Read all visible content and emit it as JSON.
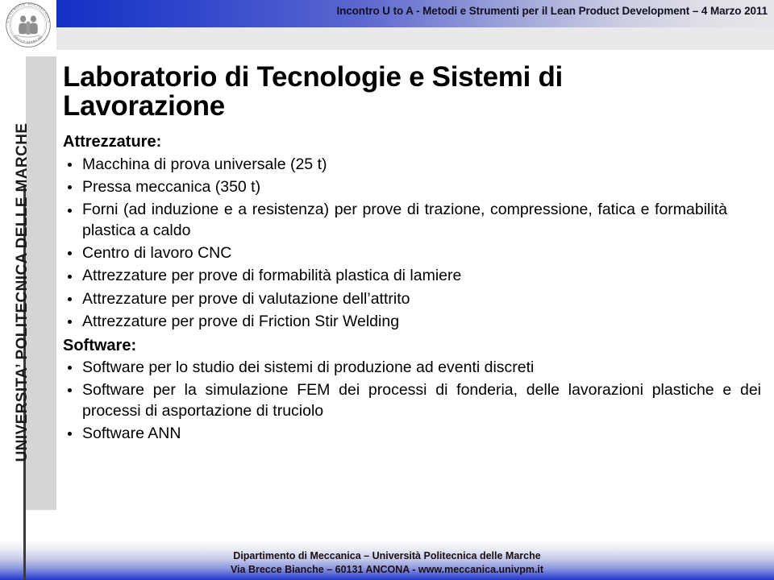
{
  "header": {
    "title": "Incontro U to A - Metodi e Strumenti per il Lean Product Development – 4 Marzo 2011",
    "gradient_start": "#1430c4",
    "gradient_end": "#e6e6ea",
    "text_color": "#111122"
  },
  "sidebar": {
    "vertical_label": "UNIVERSITA’ POLITECNICA DELLE MARCHE",
    "logo_name": "university-seal",
    "logo_ring_text_top": "UNIVERSITA’ POLITECNICA",
    "logo_ring_text_bottom": "DELLE MARCHE",
    "band_color": "#d5d5d5",
    "rule_color": "#3a3a3a"
  },
  "slide": {
    "title": "Laboratorio di Tecnologie e Sistemi di Lavorazione",
    "sections": [
      {
        "heading": "Attrezzature:",
        "items": [
          "Macchina di prova universale (25 t)",
          "Pressa meccanica (350 t)",
          "Forni (ad induzione e a resistenza) per prove di trazione, compressione, fatica e formabilità plastica a caldo",
          "Centro di lavoro CNC",
          "Attrezzature per prove di formabilità plastica di lamiere",
          "Attrezzature per prove di valutazione dell’attrito",
          "Attrezzature per prove di Friction Stir Welding"
        ]
      },
      {
        "heading": "Software:",
        "items": [
          "Software per lo studio dei sistemi di produzione ad eventi discreti",
          "Software per la simulazione FEM dei processi di fonderia, delle lavorazioni plastiche e dei processi di asportazione di truciolo",
          "Software ANN"
        ]
      }
    ]
  },
  "footer": {
    "line1": "Dipartimento di Meccanica – Università Politecnica delle Marche",
    "line2": "Via Brecce Bianche – 60131 ANCONA - www.meccanica.univpm.it",
    "text_color": "#1a0e12",
    "gradient_top": "#ffffff",
    "gradient_bottom": "#2438c9"
  }
}
